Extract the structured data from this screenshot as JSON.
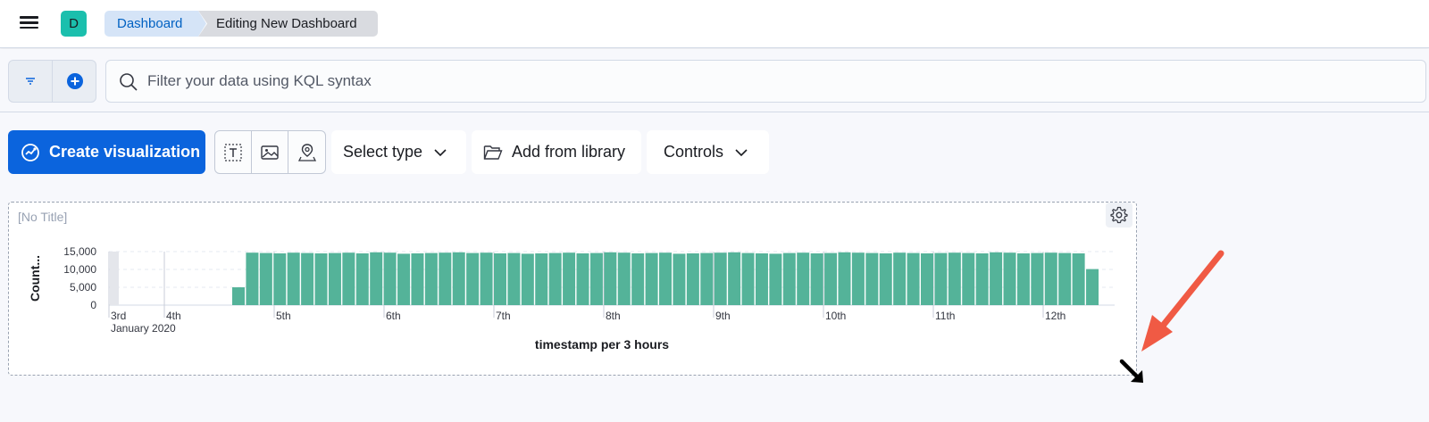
{
  "header": {
    "avatar_letter": "D",
    "breadcrumbs": [
      "Dashboard",
      "Editing New Dashboard"
    ]
  },
  "query": {
    "placeholder": "Filter your data using KQL syntax"
  },
  "toolbar": {
    "create_label": "Create visualization",
    "select_type_label": "Select type",
    "add_library_label": "Add from library",
    "controls_label": "Controls"
  },
  "panel": {
    "title": "[No Title]"
  },
  "chart_data": {
    "type": "bar",
    "xlabel": "timestamp per 3 hours",
    "ylabel": "Count...",
    "ylim": [
      0,
      15000
    ],
    "y_ticks": [
      "15,000",
      "10,000",
      "5,000",
      "0"
    ],
    "y_tick_values": [
      15000,
      10000,
      5000,
      0
    ],
    "x_tick_labels": [
      "3rd",
      "4th",
      "5th",
      "6th",
      "7th",
      "8th",
      "9th",
      "10th",
      "11th",
      "12th"
    ],
    "x_sub_label": "January 2020",
    "grid": "horizontal dashed",
    "color": "#54b399",
    "values": [
      5000,
      14700,
      14600,
      14500,
      14700,
      14600,
      14500,
      14600,
      14700,
      14500,
      14800,
      14700,
      14400,
      14500,
      14600,
      14700,
      14800,
      14600,
      14700,
      14500,
      14600,
      14400,
      14500,
      14600,
      14700,
      14500,
      14600,
      14800,
      14700,
      14500,
      14600,
      14700,
      14400,
      14500,
      14600,
      14700,
      14800,
      14600,
      14500,
      14400,
      14600,
      14700,
      14500,
      14600,
      14800,
      14700,
      14600,
      14500,
      14700,
      14600,
      14500,
      14600,
      14700,
      14600,
      14500,
      14800,
      14700,
      14500,
      14600,
      14700,
      14600,
      14500,
      10100
    ]
  },
  "colors": {
    "primary": "#0b64dd",
    "bar": "#54b399",
    "annotation_arrow": "#f05a44",
    "avatar": "#1bbfad"
  }
}
